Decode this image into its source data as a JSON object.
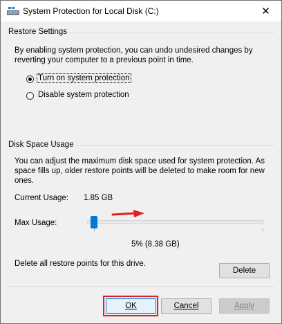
{
  "window": {
    "title": "System Protection for Local Disk (C:)",
    "close_glyph": "✕"
  },
  "restore": {
    "group_label": "Restore Settings",
    "description_line1": "By enabling system protection, you can undo undesired changes by",
    "description_line2": "reverting your computer to a previous point in time.",
    "option_on": "Turn on system protection",
    "option_off": "Disable system protection",
    "selected": "on"
  },
  "disk": {
    "group_label": "Disk Space Usage",
    "description_line1": "You can adjust the maximum disk space used for system protection. As",
    "description_line2": "space fills up, older restore points will be deleted to make room for new",
    "description_line3": "ones.",
    "current_usage_label": "Current Usage:",
    "current_usage_value": "1.85 GB",
    "max_usage_label": "Max Usage:",
    "max_usage_value_text": "5% (8.38 GB)",
    "max_usage_percent": 5,
    "delete_text": "Delete all restore points for this drive.",
    "delete_button": "Delete"
  },
  "buttons": {
    "ok": "OK",
    "cancel": "Cancel",
    "apply": "Apply"
  },
  "colors": {
    "annotation": "#e02020",
    "accent": "#0078d7"
  }
}
